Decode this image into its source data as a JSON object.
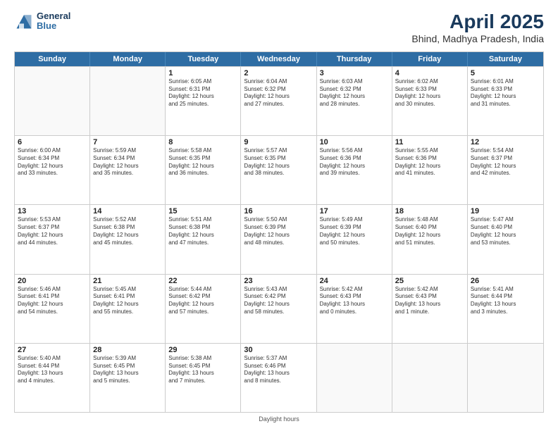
{
  "header": {
    "logo": {
      "general": "General",
      "blue": "Blue"
    },
    "title": "April 2025",
    "subtitle": "Bhind, Madhya Pradesh, India"
  },
  "calendar": {
    "weekdays": [
      "Sunday",
      "Monday",
      "Tuesday",
      "Wednesday",
      "Thursday",
      "Friday",
      "Saturday"
    ],
    "rows": [
      [
        {
          "day": "",
          "info": ""
        },
        {
          "day": "",
          "info": ""
        },
        {
          "day": "1",
          "info": "Sunrise: 6:05 AM\nSunset: 6:31 PM\nDaylight: 12 hours\nand 25 minutes."
        },
        {
          "day": "2",
          "info": "Sunrise: 6:04 AM\nSunset: 6:32 PM\nDaylight: 12 hours\nand 27 minutes."
        },
        {
          "day": "3",
          "info": "Sunrise: 6:03 AM\nSunset: 6:32 PM\nDaylight: 12 hours\nand 28 minutes."
        },
        {
          "day": "4",
          "info": "Sunrise: 6:02 AM\nSunset: 6:33 PM\nDaylight: 12 hours\nand 30 minutes."
        },
        {
          "day": "5",
          "info": "Sunrise: 6:01 AM\nSunset: 6:33 PM\nDaylight: 12 hours\nand 31 minutes."
        }
      ],
      [
        {
          "day": "6",
          "info": "Sunrise: 6:00 AM\nSunset: 6:34 PM\nDaylight: 12 hours\nand 33 minutes."
        },
        {
          "day": "7",
          "info": "Sunrise: 5:59 AM\nSunset: 6:34 PM\nDaylight: 12 hours\nand 35 minutes."
        },
        {
          "day": "8",
          "info": "Sunrise: 5:58 AM\nSunset: 6:35 PM\nDaylight: 12 hours\nand 36 minutes."
        },
        {
          "day": "9",
          "info": "Sunrise: 5:57 AM\nSunset: 6:35 PM\nDaylight: 12 hours\nand 38 minutes."
        },
        {
          "day": "10",
          "info": "Sunrise: 5:56 AM\nSunset: 6:36 PM\nDaylight: 12 hours\nand 39 minutes."
        },
        {
          "day": "11",
          "info": "Sunrise: 5:55 AM\nSunset: 6:36 PM\nDaylight: 12 hours\nand 41 minutes."
        },
        {
          "day": "12",
          "info": "Sunrise: 5:54 AM\nSunset: 6:37 PM\nDaylight: 12 hours\nand 42 minutes."
        }
      ],
      [
        {
          "day": "13",
          "info": "Sunrise: 5:53 AM\nSunset: 6:37 PM\nDaylight: 12 hours\nand 44 minutes."
        },
        {
          "day": "14",
          "info": "Sunrise: 5:52 AM\nSunset: 6:38 PM\nDaylight: 12 hours\nand 45 minutes."
        },
        {
          "day": "15",
          "info": "Sunrise: 5:51 AM\nSunset: 6:38 PM\nDaylight: 12 hours\nand 47 minutes."
        },
        {
          "day": "16",
          "info": "Sunrise: 5:50 AM\nSunset: 6:39 PM\nDaylight: 12 hours\nand 48 minutes."
        },
        {
          "day": "17",
          "info": "Sunrise: 5:49 AM\nSunset: 6:39 PM\nDaylight: 12 hours\nand 50 minutes."
        },
        {
          "day": "18",
          "info": "Sunrise: 5:48 AM\nSunset: 6:40 PM\nDaylight: 12 hours\nand 51 minutes."
        },
        {
          "day": "19",
          "info": "Sunrise: 5:47 AM\nSunset: 6:40 PM\nDaylight: 12 hours\nand 53 minutes."
        }
      ],
      [
        {
          "day": "20",
          "info": "Sunrise: 5:46 AM\nSunset: 6:41 PM\nDaylight: 12 hours\nand 54 minutes."
        },
        {
          "day": "21",
          "info": "Sunrise: 5:45 AM\nSunset: 6:41 PM\nDaylight: 12 hours\nand 55 minutes."
        },
        {
          "day": "22",
          "info": "Sunrise: 5:44 AM\nSunset: 6:42 PM\nDaylight: 12 hours\nand 57 minutes."
        },
        {
          "day": "23",
          "info": "Sunrise: 5:43 AM\nSunset: 6:42 PM\nDaylight: 12 hours\nand 58 minutes."
        },
        {
          "day": "24",
          "info": "Sunrise: 5:42 AM\nSunset: 6:43 PM\nDaylight: 13 hours\nand 0 minutes."
        },
        {
          "day": "25",
          "info": "Sunrise: 5:42 AM\nSunset: 6:43 PM\nDaylight: 13 hours\nand 1 minute."
        },
        {
          "day": "26",
          "info": "Sunrise: 5:41 AM\nSunset: 6:44 PM\nDaylight: 13 hours\nand 3 minutes."
        }
      ],
      [
        {
          "day": "27",
          "info": "Sunrise: 5:40 AM\nSunset: 6:44 PM\nDaylight: 13 hours\nand 4 minutes."
        },
        {
          "day": "28",
          "info": "Sunrise: 5:39 AM\nSunset: 6:45 PM\nDaylight: 13 hours\nand 5 minutes."
        },
        {
          "day": "29",
          "info": "Sunrise: 5:38 AM\nSunset: 6:45 PM\nDaylight: 13 hours\nand 7 minutes."
        },
        {
          "day": "30",
          "info": "Sunrise: 5:37 AM\nSunset: 6:46 PM\nDaylight: 13 hours\nand 8 minutes."
        },
        {
          "day": "",
          "info": ""
        },
        {
          "day": "",
          "info": ""
        },
        {
          "day": "",
          "info": ""
        }
      ]
    ]
  },
  "footer": {
    "text": "Daylight hours"
  }
}
